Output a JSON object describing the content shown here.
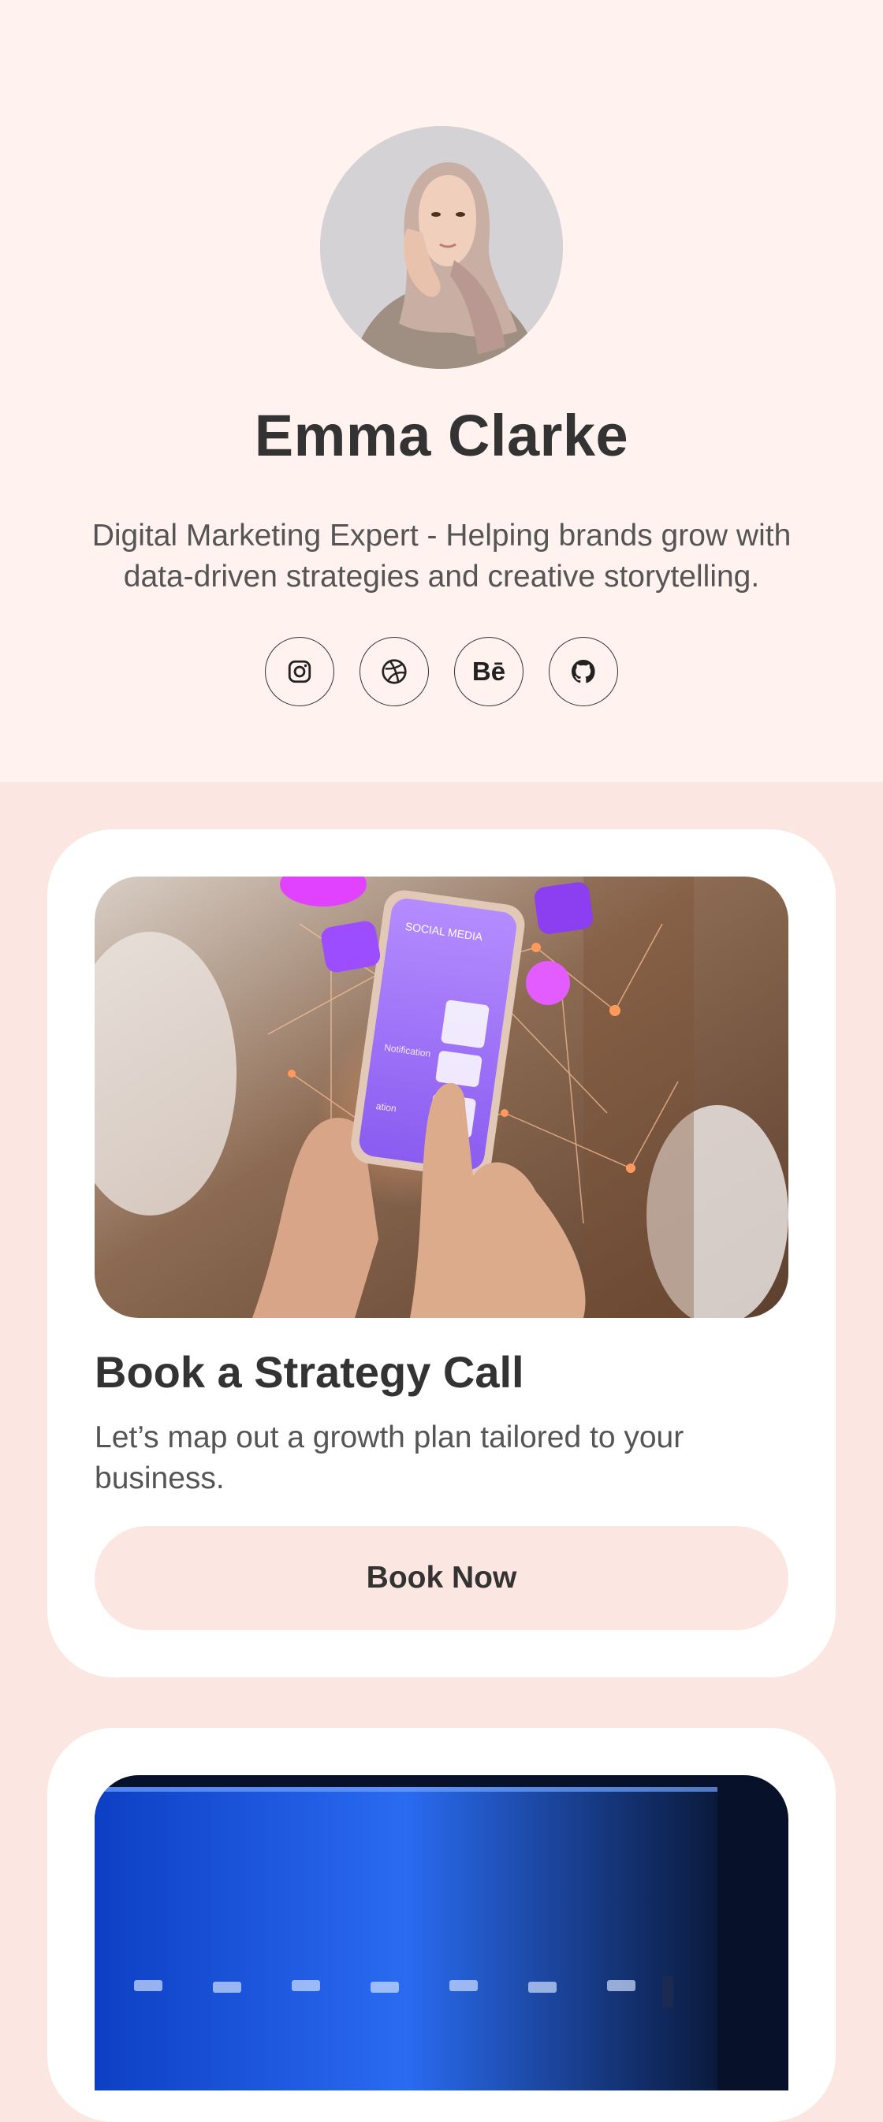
{
  "profile": {
    "name": "Emma Clarke",
    "bio": "Digital Marketing Expert - Helping brands grow with data-driven strategies and creative storytelling."
  },
  "socials": [
    {
      "icon": "instagram-icon",
      "label": ""
    },
    {
      "icon": "dribbble-icon",
      "label": ""
    },
    {
      "icon": "behance-icon",
      "label": "Bē"
    },
    {
      "icon": "github-icon",
      "label": ""
    }
  ],
  "cards": [
    {
      "title": "Book a Strategy Call",
      "description": "Let’s map out a growth plan tailored to your business.",
      "button_label": "Book Now"
    }
  ],
  "phone_screen": {
    "header_text": "SOCIAL MEDIA",
    "item_1": "Notification",
    "item_2": "ation"
  },
  "colors": {
    "hero_bg": "#fff2ef",
    "page_bg": "#fce6e1",
    "button_bg": "#fce6e1",
    "text": "#333333"
  }
}
